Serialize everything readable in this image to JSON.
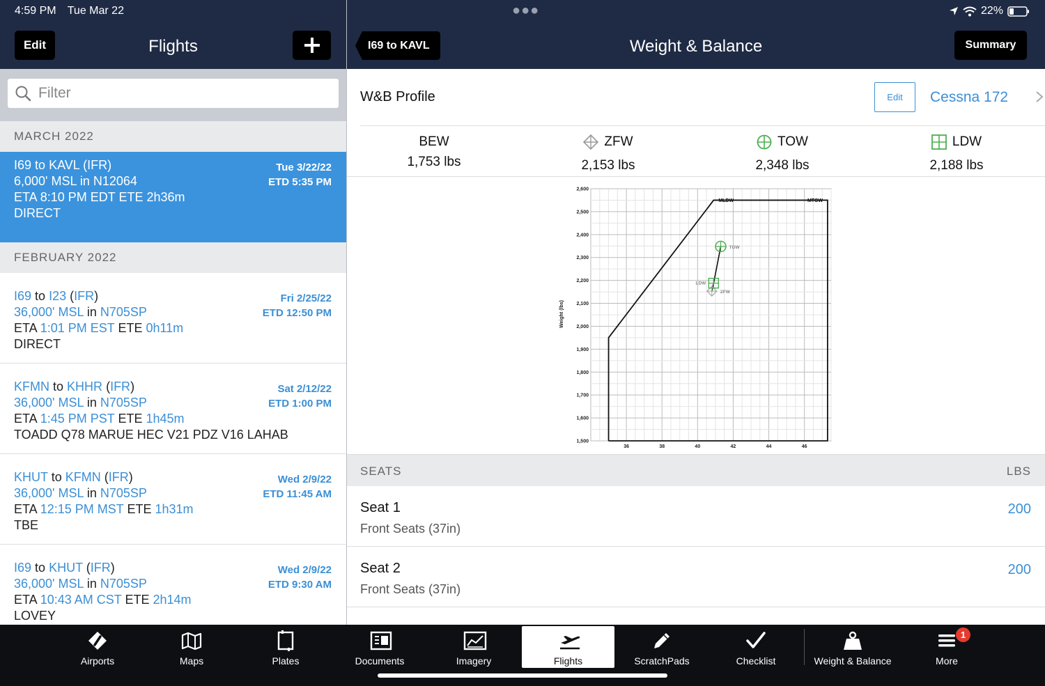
{
  "status": {
    "time": "4:59 PM",
    "date": "Tue Mar 22",
    "battery": "22%"
  },
  "left": {
    "edit_label": "Edit",
    "title": "Flights",
    "filter_placeholder": "Filter",
    "sections": [
      {
        "label": "MARCH 2022"
      },
      {
        "label": "FEBRUARY 2022"
      }
    ],
    "flights": [
      {
        "from": "I69",
        "to": "KAVL",
        "rules": "IFR",
        "alt": "6,000' MSL",
        "aircraft": "N12064",
        "eta": "8:10 PM EDT",
        "ete": "2h36m",
        "route": "DIRECT",
        "date": "Tue 3/22/22",
        "etd": "ETD 5:35 PM"
      },
      {
        "from": "I69",
        "to": "I23",
        "rules": "IFR",
        "alt": "36,000' MSL",
        "aircraft": "N705SP",
        "eta": "1:01 PM EST",
        "ete": "0h11m",
        "route": "DIRECT",
        "date": "Fri 2/25/22",
        "etd": "ETD 12:50 PM"
      },
      {
        "from": "KFMN",
        "to": "KHHR",
        "rules": "IFR",
        "alt": "36,000' MSL",
        "aircraft": "N705SP",
        "eta": "1:45 PM PST",
        "ete": "1h45m",
        "route": "TOADD Q78 MARUE HEC V21 PDZ V16 LAHAB",
        "date": "Sat 2/12/22",
        "etd": "ETD 1:00 PM"
      },
      {
        "from": "KHUT",
        "to": "KFMN",
        "rules": "IFR",
        "alt": "36,000' MSL",
        "aircraft": "N705SP",
        "eta": "12:15 PM MST",
        "ete": "1h31m",
        "route": "TBE",
        "date": "Wed 2/9/22",
        "etd": "ETD 11:45 AM"
      },
      {
        "from": "I69",
        "to": "KHUT",
        "rules": "IFR",
        "alt": "36,000' MSL",
        "aircraft": "N705SP",
        "eta": "10:43 AM CST",
        "ete": "2h14m",
        "route": "LOVEY",
        "date": "Wed 2/9/22",
        "etd": "ETD 9:30 AM"
      }
    ],
    "words": {
      "to": "to",
      "in": "in",
      "eta": "ETA",
      "ete": "ETE"
    }
  },
  "right": {
    "back_label": "I69 to KAVL",
    "title": "Weight & Balance",
    "summary_label": "Summary",
    "profile": {
      "label": "W&B Profile",
      "edit_label": "Edit",
      "name": "Cessna 172"
    },
    "weights": [
      {
        "label": "BEW",
        "value": "1,753 lbs",
        "icon": "none"
      },
      {
        "label": "ZFW",
        "value": "2,153 lbs",
        "icon": "diamond-crosshair-icon"
      },
      {
        "label": "TOW",
        "value": "2,348 lbs",
        "icon": "circle-crosshair-icon"
      },
      {
        "label": "LDW",
        "value": "2,188 lbs",
        "icon": "square-crosshair-icon"
      }
    ],
    "seats_header": "SEATS",
    "seats_unit": "LBS",
    "seats": [
      {
        "name": "Seat 1",
        "sub": "Front Seats (37in)",
        "value": "200"
      },
      {
        "name": "Seat 2",
        "sub": "Front Seats (37in)",
        "value": "200"
      }
    ]
  },
  "chart_data": {
    "type": "line",
    "ylabel": "Weight (lbs)",
    "xlabel": "",
    "xlim": [
      34,
      47.5
    ],
    "ylim": [
      1500,
      2600
    ],
    "x_ticks": [
      36,
      38,
      40,
      42,
      44,
      46
    ],
    "y_ticks": [
      1500,
      1600,
      1700,
      1800,
      1900,
      2000,
      2100,
      2200,
      2300,
      2400,
      2500,
      2600
    ],
    "envelope": [
      [
        35,
        1500
      ],
      [
        35,
        1950
      ],
      [
        40.9,
        2550
      ],
      [
        47.3,
        2550
      ],
      [
        47.3,
        1500
      ],
      [
        35,
        1500
      ]
    ],
    "envelope_labels": [
      {
        "label": "MLDW",
        "x": 41.6,
        "y": 2550
      },
      {
        "label": "MTOW",
        "x": 46.6,
        "y": 2550
      }
    ],
    "points": [
      {
        "name": "TOW",
        "x": 41.3,
        "y": 2348,
        "color": "#4caf50"
      },
      {
        "name": "LDW",
        "x": 40.9,
        "y": 2188,
        "color": "#4caf50"
      },
      {
        "name": "ZFW",
        "x": 40.8,
        "y": 2153,
        "color": "#aaaaaa"
      }
    ]
  },
  "tabs": [
    {
      "label": "Airports",
      "icon": "airport-icon"
    },
    {
      "label": "Maps",
      "icon": "map-icon"
    },
    {
      "label": "Plates",
      "icon": "plate-icon"
    },
    {
      "label": "Documents",
      "icon": "documents-icon"
    },
    {
      "label": "Imagery",
      "icon": "imagery-icon"
    },
    {
      "label": "Flights",
      "icon": "airplane-icon",
      "active": true
    },
    {
      "label": "ScratchPads",
      "icon": "pencil-icon"
    },
    {
      "label": "Checklist",
      "icon": "checkmark-icon"
    },
    {
      "label": "Weight & Balance",
      "icon": "weight-icon"
    },
    {
      "label": "More",
      "icon": "menu-icon",
      "badge": "1"
    }
  ],
  "colors": {
    "header": "#1f2b45",
    "accent": "#3b8fd6",
    "selected": "#3b93dd",
    "tabbar": "#0d0f13",
    "badge": "#e53b30"
  }
}
